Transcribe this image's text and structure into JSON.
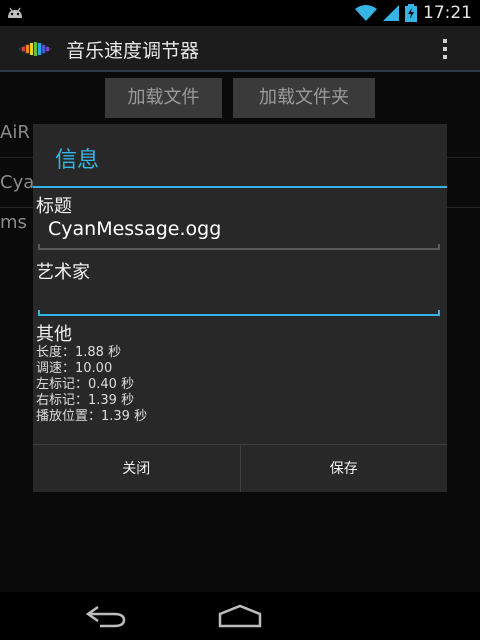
{
  "status_bar": {
    "time": "17:21",
    "icons": [
      "android-icon",
      "wifi-icon",
      "signal-icon",
      "battery-charging-icon"
    ]
  },
  "action_bar": {
    "title": "音乐速度调节器",
    "logo_icon": "equalizer-logo-icon",
    "overflow_icon": "overflow-menu-icon"
  },
  "main": {
    "load_file_label": "加载文件",
    "load_folder_label": "加载文件夹",
    "list_items": [
      "AiR",
      "Cya",
      "ms"
    ]
  },
  "dialog": {
    "title": "信息",
    "title_label": "标题",
    "title_value": "CyanMessage.ogg",
    "artist_label": "艺术家",
    "artist_value": "",
    "other_label": "其他",
    "info_lines": [
      "长度：1.88 秒",
      "调速：10.00",
      "左标记：0.40 秒",
      "右标记：1.39 秒",
      "播放位置：1.39 秒"
    ],
    "close_label": "关闭",
    "save_label": "保存"
  },
  "nav_bar": {
    "icons": [
      "back-icon",
      "home-icon"
    ]
  },
  "colors": {
    "accent": "#35b5e5",
    "dialog_bg": "#282828",
    "action_bar_bg": "#1c1c1c"
  }
}
